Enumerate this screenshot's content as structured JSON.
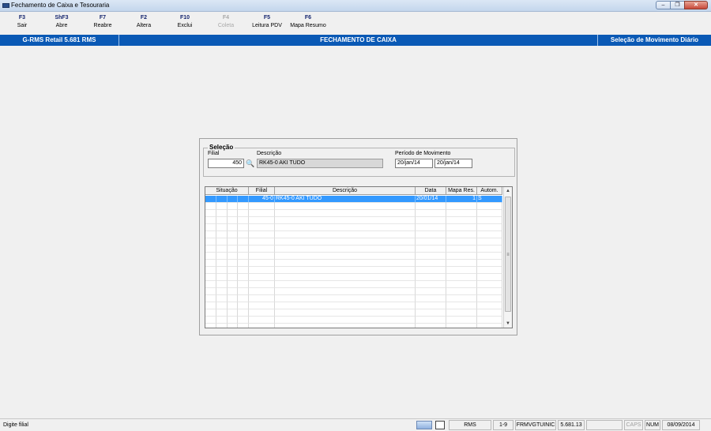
{
  "window": {
    "title": "Fechamento de Caixa e Tesouraria",
    "controls": {
      "minimize": "–",
      "restore": "❐",
      "close": "✕"
    }
  },
  "toolbar": [
    {
      "key": "F3",
      "label": "Sair",
      "enabled": true
    },
    {
      "key": "ShF3",
      "label": "Abre",
      "enabled": true
    },
    {
      "key": "F7",
      "label": "Reabre",
      "enabled": true
    },
    {
      "key": "F2",
      "label": "Altera",
      "enabled": true
    },
    {
      "key": "F10",
      "label": "Exclui",
      "enabled": true
    },
    {
      "key": "F4",
      "label": "Coleta",
      "enabled": false
    },
    {
      "key": "F5",
      "label": "Leitura PDV",
      "enabled": true
    },
    {
      "key": "F6",
      "label": "Mapa Resumo",
      "enabled": true
    }
  ],
  "header": {
    "left": "G-RMS Retail 5.681 RMS",
    "center": "FECHAMENTO DE CAIXA",
    "right": "Seleção de Movimento Diário"
  },
  "selection": {
    "title": "Seleção",
    "filial_label": "Filial",
    "filial_value": "450",
    "descricao_label": "Descrição",
    "descricao_value": "RK45-0 AKI TUDO",
    "periodo_label": "Período de Movimento",
    "periodo_inicio": "20/jan/14",
    "periodo_fim": "20/jan/14",
    "search_icon": "binoculars-icon"
  },
  "grid": {
    "columns": [
      "Situação",
      "Filial",
      "Descrição",
      "Data",
      "Mapa Res.",
      "Autom."
    ],
    "rows": [
      {
        "filial": "45-0",
        "descricao": "RK45-0 AKI TUDO",
        "data": "20/01/14",
        "mapa": "1",
        "autom": "S",
        "selected": true
      }
    ],
    "scroll_up": "▲",
    "scroll_down": "▼",
    "scroll_grip": "≡"
  },
  "status": {
    "message": "Digite filial",
    "system": "RMS",
    "range": "1-9",
    "program": "FRMVGTUINIC",
    "version": "5.681.13",
    "caps": "CAPS",
    "num": "NUM",
    "date": "08/09/2014"
  },
  "colors": {
    "header_blue": "#0a59b5",
    "selection_blue": "#3399ff",
    "toolbar_key": "#14246e"
  }
}
